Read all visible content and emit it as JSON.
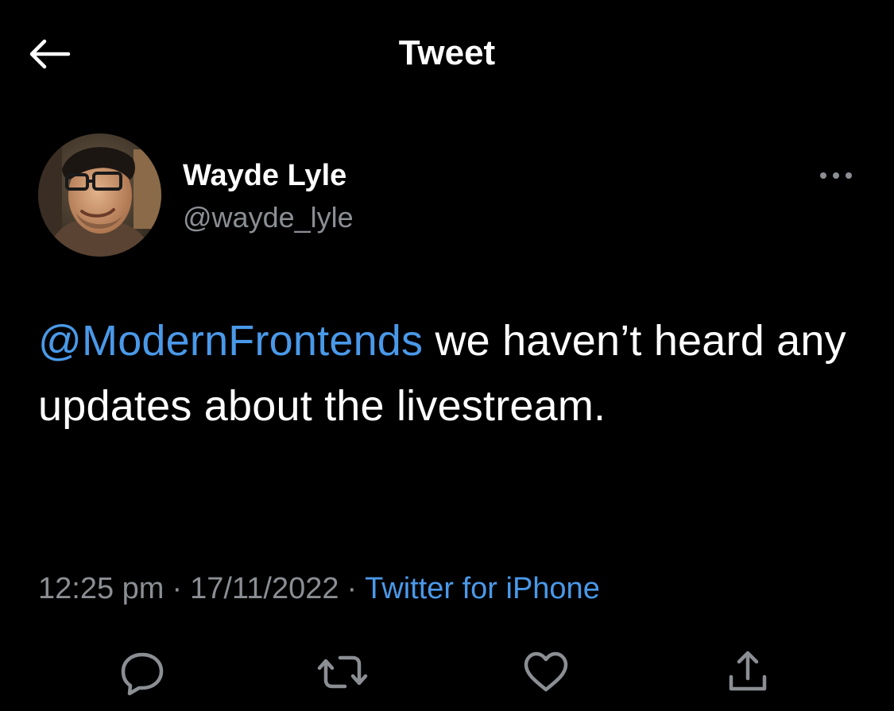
{
  "header": {
    "title": "Tweet",
    "back_icon": "arrow-left-icon"
  },
  "author": {
    "display_name": "Wayde Lyle",
    "handle": "@wayde_lyle",
    "more_icon": "more-horizontal-icon"
  },
  "tweet": {
    "mention": "@ModernFrontends",
    "body": " we haven’t heard any updates about the livestream."
  },
  "meta": {
    "time": "12:25 pm",
    "separator": "·",
    "date": "17/11/2022",
    "source": "Twitter for iPhone"
  },
  "actions": [
    {
      "name": "reply",
      "icon": "reply-icon"
    },
    {
      "name": "retweet",
      "icon": "retweet-icon"
    },
    {
      "name": "like",
      "icon": "heart-icon"
    },
    {
      "name": "share",
      "icon": "share-icon"
    }
  ],
  "colors": {
    "background": "#000000",
    "text_primary": "#ffffff",
    "text_secondary": "#8b8f94",
    "link": "#4a99e9"
  }
}
